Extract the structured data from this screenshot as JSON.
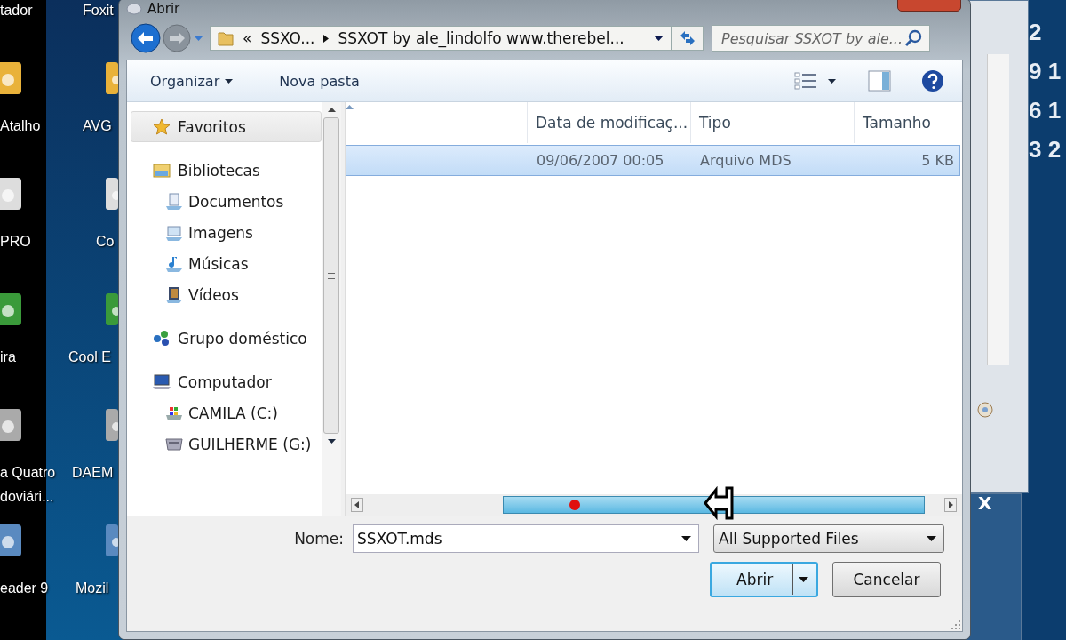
{
  "desktop": {
    "icons": [
      {
        "label": "tador"
      },
      {
        "label": "Foxit"
      },
      {
        "label": "Atalho"
      },
      {
        "label": "AVG"
      },
      {
        "label": "PRO"
      },
      {
        "label": "Co"
      },
      {
        "label": "ira"
      },
      {
        "label": "Cool E"
      },
      {
        "label": "a Quatro doviári..."
      },
      {
        "label": "DAEM"
      },
      {
        "label": "eader 9"
      },
      {
        "label": "Mozil"
      }
    ]
  },
  "background_window": {
    "digits": [
      "2",
      "9 1",
      "6 1",
      "3 2"
    ],
    "close": "X"
  },
  "dialog": {
    "title": "Abrir",
    "address": {
      "crumbs": [
        "«",
        "SSXO...",
        "SSXOT by ale_lindolfo www.therebel..."
      ]
    },
    "search": {
      "placeholder": "Pesquisar SSXOT by ale..."
    },
    "toolbar": [
      {
        "label": "Organizar",
        "dropdown": true
      },
      {
        "label": "Nova pasta",
        "dropdown": false
      }
    ],
    "nav": [
      {
        "label": "Favoritos",
        "kind": "star",
        "selected": true
      },
      {
        "label": "Bibliotecas",
        "kind": "library",
        "selected": false,
        "children": [
          {
            "label": "Documentos",
            "kind": "document",
            "selected": false
          },
          {
            "label": "Imagens",
            "kind": "picture",
            "selected": false
          },
          {
            "label": "Músicas",
            "kind": "music",
            "selected": false
          },
          {
            "label": "Vídeos",
            "kind": "video",
            "selected": false
          }
        ]
      },
      {
        "label": "Grupo doméstico",
        "kind": "homegroup",
        "selected": false
      },
      {
        "label": "Computador",
        "kind": "computer",
        "selected": false,
        "children": [
          {
            "label": "CAMILA (C:)",
            "kind": "system-drive",
            "selected": false
          },
          {
            "label": "GUILHERME (G:)",
            "kind": "drive",
            "selected": false
          }
        ]
      }
    ],
    "columns": [
      "Data de modificaç...",
      "Tipo",
      "Tamanho"
    ],
    "rows": [
      {
        "date": "09/06/2007 00:05",
        "type": "Arquivo MDS",
        "size": "5 KB",
        "selected": true
      }
    ],
    "name_label": "Nome:",
    "filename": "SSXOT.mds",
    "filter": "All Supported Files",
    "buttons": [
      {
        "label": "Abrir",
        "kind": "split",
        "default": true
      },
      {
        "label": "Cancelar",
        "kind": "plain",
        "default": false
      }
    ]
  }
}
